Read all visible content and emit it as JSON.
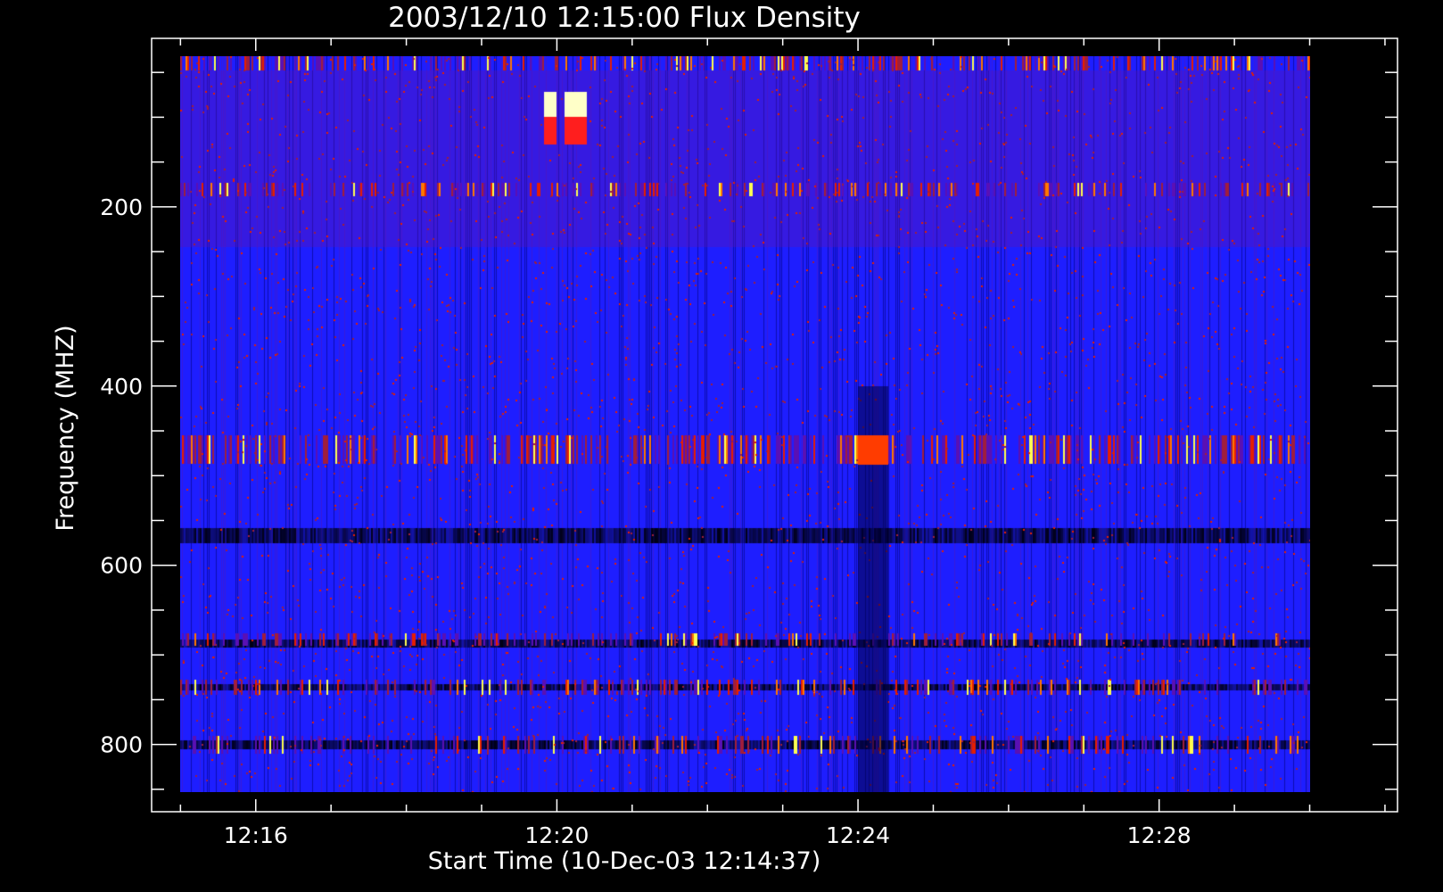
{
  "chart_data": {
    "type": "heatmap",
    "title": "2003/12/10 12:15:00 Flux Density",
    "xlabel": "Start Time (10-Dec-03 12:14:37)",
    "ylabel": "Frequency (MHZ)",
    "x_tick_labels": [
      "12:16",
      "12:20",
      "12:24",
      "12:28"
    ],
    "x_tick_minutes": [
      16,
      20,
      24,
      28
    ],
    "y_ticks": [
      200,
      400,
      600,
      800
    ],
    "xlim": [
      "12:14:37",
      "12:31:10"
    ],
    "ylim": [
      875,
      12
    ],
    "data_range": {
      "time_start_min": 15.0,
      "time_end_min": 30.0,
      "freq_start": 32,
      "freq_end": 853
    },
    "colormap": [
      "#000000",
      "#0000c8",
      "#1e1eff",
      "#5a10b4",
      "#a01e3c",
      "#e61e00",
      "#ff7800",
      "#ffff50",
      "#ffffc8"
    ],
    "background_color": "#1e1eff",
    "strong_bands_mhz": [
      {
        "from": 455,
        "to": 487,
        "level": 0.8
      },
      {
        "from": 173,
        "to": 188,
        "level": 0.55
      },
      {
        "from": 32,
        "to": 48,
        "level": 0.6
      },
      {
        "from": 676,
        "to": 690,
        "level": 0.45
      },
      {
        "from": 728,
        "to": 745,
        "level": 0.45
      },
      {
        "from": 790,
        "to": 810,
        "level": 0.35
      }
    ],
    "dark_bands_mhz": [
      {
        "from": 558,
        "to": 575
      },
      {
        "from": 683,
        "to": 692
      },
      {
        "from": 733,
        "to": 740
      },
      {
        "from": 795,
        "to": 805
      }
    ],
    "bright_patches": [
      {
        "t0": 19.83,
        "t1": 20.0,
        "f0": 72,
        "f1": 100,
        "color": "#ffffc8"
      },
      {
        "t0": 19.83,
        "t1": 20.0,
        "f0": 100,
        "f1": 130,
        "color": "#ff1e1e"
      },
      {
        "t0": 20.1,
        "t1": 20.4,
        "f0": 72,
        "f1": 100,
        "color": "#ffffc8"
      },
      {
        "t0": 20.1,
        "t1": 20.4,
        "f0": 100,
        "f1": 130,
        "color": "#ff1e1e"
      },
      {
        "t0": 24.0,
        "t1": 24.4,
        "f0": 455,
        "f1": 488,
        "color": "#ff3c00"
      }
    ]
  }
}
